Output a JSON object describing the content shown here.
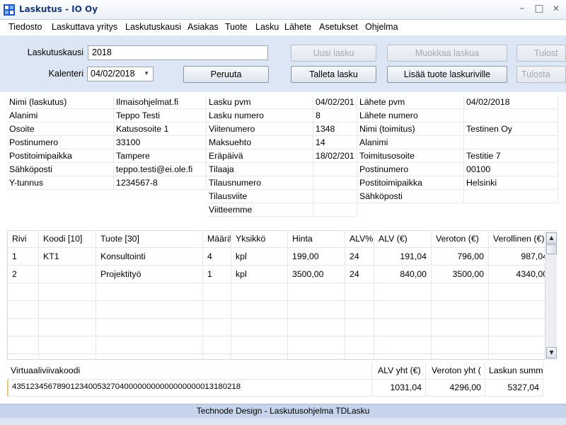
{
  "window": {
    "title": "Laskutus - IO Oy",
    "minimize_glyph": "–",
    "maximize_glyph": "□",
    "close_glyph": "✕"
  },
  "menu": [
    "Tiedosto",
    "Laskuttava yritys",
    "Laskutuskausi",
    "Asiakas",
    "Tuote",
    "Lasku",
    "Lähete",
    "Asetukset",
    "Ohjelma"
  ],
  "toolbar": {
    "period_label": "Laskutuskausi",
    "period_value": "2018",
    "calendar_label": "Kalenteri",
    "calendar_value": "04/02/2018",
    "cancel": "Peruuta",
    "new_invoice": "Uusi lasku",
    "save_invoice": "Talleta lasku",
    "edit_invoice": "Muokkaa laskua",
    "add_product": "Lisää tuote laskuriville",
    "print1": "Tulost",
    "print2": "Tulosta"
  },
  "info": {
    "col1": [
      [
        "Nimi (laskutus)",
        "Ilmaisohjelmat.fi"
      ],
      [
        "Alanimi",
        "Teppo Testi"
      ],
      [
        "Osoite",
        "Katusosoite 1"
      ],
      [
        "Postinumero",
        "33100"
      ],
      [
        "Postitoimipaikka",
        "Tampere"
      ],
      [
        "Sähköposti",
        "teppo.testi@ei.ole.fi"
      ],
      [
        "Y-tunnus",
        "1234567-8"
      ]
    ],
    "col2": [
      [
        "Lasku pvm",
        "04/02/201"
      ],
      [
        "Lasku numero",
        "8"
      ],
      [
        "Viitenumero",
        "1348"
      ],
      [
        "Maksuehto",
        "14"
      ],
      [
        "Eräpäivä",
        "18/02/201"
      ],
      [
        "Tilaaja",
        ""
      ],
      [
        "Tilausnumero",
        ""
      ],
      [
        "Tilausviite",
        ""
      ],
      [
        "Viitteemme",
        ""
      ]
    ],
    "col3": [
      [
        "Lähete pvm",
        "04/02/2018"
      ],
      [
        "Lähete numero",
        ""
      ],
      [
        "Nimi (toimitus)",
        "Testinen Oy"
      ],
      [
        "Alanimi",
        ""
      ],
      [
        "Toimitusosoite",
        "Testitie 7"
      ],
      [
        "Postinumero",
        "00100"
      ],
      [
        "Postitoimipaikka",
        "Helsinki"
      ],
      [
        "Sähköposti",
        ""
      ]
    ]
  },
  "grid": {
    "headers": [
      "Rivi",
      "Koodi [10]",
      "Tuote [30]",
      "Määrä",
      "Yksikkö",
      "Hinta",
      "ALV%",
      "ALV (€)",
      "Veroton (€)",
      "Verollinen (€)"
    ],
    "rows": [
      [
        "1",
        "KT1",
        "Konsultointi",
        "4",
        "kpl",
        "199,00",
        "24",
        "191,04",
        "796,00",
        "987,04"
      ],
      [
        "2",
        "",
        "Projektityö",
        "1",
        "kpl",
        "3500,00",
        "24",
        "840,00",
        "3500,00",
        "4340,00"
      ]
    ]
  },
  "totals": {
    "barcode_label": "Virtuaaliviivakoodi",
    "barcode_value": "435123456789012340053270400000000000000000013180218",
    "vat_label": "ALV yht (€)",
    "vat_value": "1031,04",
    "net_label": "Veroton yht (",
    "net_value": "4296,00",
    "sum_label": "Laskun summ",
    "sum_value": "5327,04"
  },
  "status": "Technode Design - Laskutusohjelma TDLasku",
  "colors": {
    "accent": "#1a3a7a",
    "panel": "#dde6f4",
    "statusbar": "#c5d4ea"
  }
}
